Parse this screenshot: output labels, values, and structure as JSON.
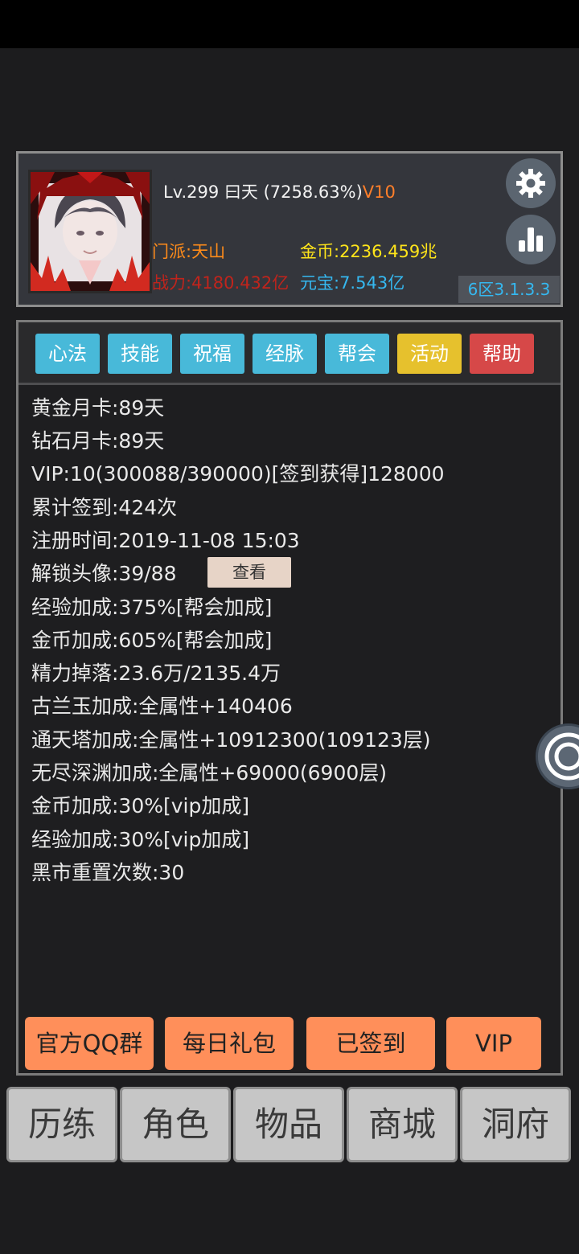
{
  "header": {
    "level": "Lv.299 曰天 (7258.63%)",
    "vip": "V10",
    "sect": "门派:天山",
    "gold": "金币:2236.459兆",
    "power": "战力:4180.432亿",
    "ingot": "元宝:7.543亿",
    "server": "6区3.1.3.3",
    "icons": [
      "gear-icon",
      "bar-chart-icon"
    ]
  },
  "tabs": [
    {
      "label": "心法",
      "color": "#48b9d9"
    },
    {
      "label": "技能",
      "color": "#48b9d9"
    },
    {
      "label": "祝福",
      "color": "#48b9d9"
    },
    {
      "label": "经脉",
      "color": "#48b9d9"
    },
    {
      "label": "帮会",
      "color": "#48b9d9"
    },
    {
      "label": "活动",
      "color": "#e6c12d"
    },
    {
      "label": "帮助",
      "color": "#d64848"
    }
  ],
  "info": [
    "黄金月卡:89天",
    "钻石月卡:89天",
    "VIP:10(300088/390000)[签到获得]128000",
    "累计签到:424次",
    "注册时间:2019-11-08 15:03",
    "解锁头像:39/88",
    "经验加成:375%[帮会加成]",
    "金币加成:605%[帮会加成]",
    "精力掉落:23.6万/2135.4万",
    "古兰玉加成:全属性+140406",
    "通天塔加成:全属性+10912300(109123层)",
    "无尽深渊加成:全属性+69000(6900层)",
    "金币加成:30%[vip加成]",
    "经验加成:30%[vip加成]",
    "黑市重置次数:30"
  ],
  "view_button": "查看",
  "actions": [
    "官方QQ群",
    "每日礼包",
    "已签到",
    "VIP"
  ],
  "nav": [
    "历练",
    "角色",
    "物品",
    "商城",
    "洞府"
  ]
}
